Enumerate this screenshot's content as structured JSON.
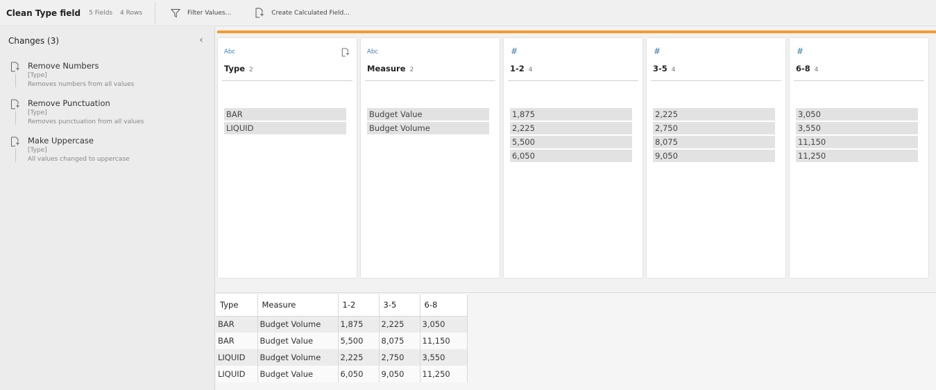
{
  "toolbar": {
    "step_title": "Clean Type field",
    "fields_count": "5 Fields",
    "rows_count": "4 Rows",
    "filter_label": "Filter Values...",
    "calc_label": "Create Calculated Field..."
  },
  "changes": {
    "header": "Changes (3)",
    "items": [
      {
        "name": "Remove Numbers",
        "field": "[Type]",
        "desc": "Removes numbers from all values"
      },
      {
        "name": "Remove Punctuation",
        "field": "[Type]",
        "desc": "Removes punctuation from all values"
      },
      {
        "name": "Make Uppercase",
        "field": "[Type]",
        "desc": "All values changed to uppercase"
      }
    ]
  },
  "profile": {
    "accent_color": "#f59a33",
    "cards": [
      {
        "type_icon": "Abc",
        "name": "Type",
        "count": "2",
        "values": [
          "BAR",
          "LIQUID"
        ]
      },
      {
        "type_icon": "Abc",
        "name": "Measure",
        "count": "2",
        "values": [
          "Budget Value",
          "Budget Volume"
        ]
      },
      {
        "type_icon": "#",
        "name": "1-2",
        "count": "4",
        "values": [
          "1,875",
          "2,225",
          "5,500",
          "6,050"
        ]
      },
      {
        "type_icon": "#",
        "name": "3-5",
        "count": "4",
        "values": [
          "2,225",
          "2,750",
          "8,075",
          "9,050"
        ]
      },
      {
        "type_icon": "#",
        "name": "6-8",
        "count": "4",
        "values": [
          "3,050",
          "3,550",
          "11,150",
          "11,250"
        ]
      }
    ]
  },
  "grid": {
    "columns": [
      "Type",
      "Measure",
      "1-2",
      "3-5",
      "6-8"
    ],
    "rows": [
      [
        "BAR",
        "Budget Volume",
        "1,875",
        "2,225",
        "3,050"
      ],
      [
        "BAR",
        "Budget Value",
        "5,500",
        "8,075",
        "11,150"
      ],
      [
        "LIQUID",
        "Budget Volume",
        "2,225",
        "2,750",
        "3,550"
      ],
      [
        "LIQUID",
        "Budget Value",
        "6,050",
        "9,050",
        "11,250"
      ]
    ]
  }
}
